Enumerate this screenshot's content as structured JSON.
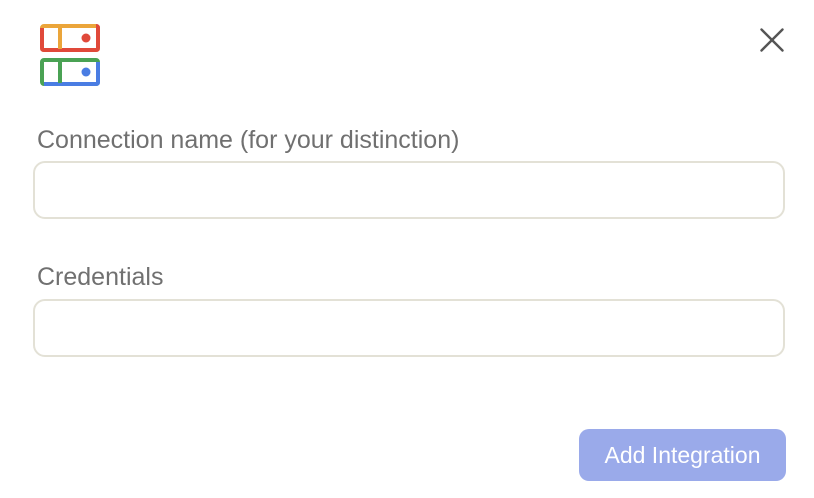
{
  "dialog": {
    "logo_icon": "integration-logo-icon",
    "close_icon": "close-icon",
    "fields": {
      "connection_name": {
        "label": "Connection name (for your distinction)",
        "value": "",
        "placeholder": ""
      },
      "credentials": {
        "label": "Credentials",
        "value": "",
        "placeholder": ""
      }
    },
    "submit_label": "Add Integration"
  },
  "colors": {
    "logo_orange": "#eba53a",
    "logo_red": "#e0493a",
    "logo_green": "#4aa254",
    "logo_blue": "#4a7de3",
    "label_text": "#707070",
    "input_border": "#e3e1d6",
    "button_bg": "#9aaaea",
    "button_text": "#ffffff",
    "close_icon": "#555555"
  }
}
